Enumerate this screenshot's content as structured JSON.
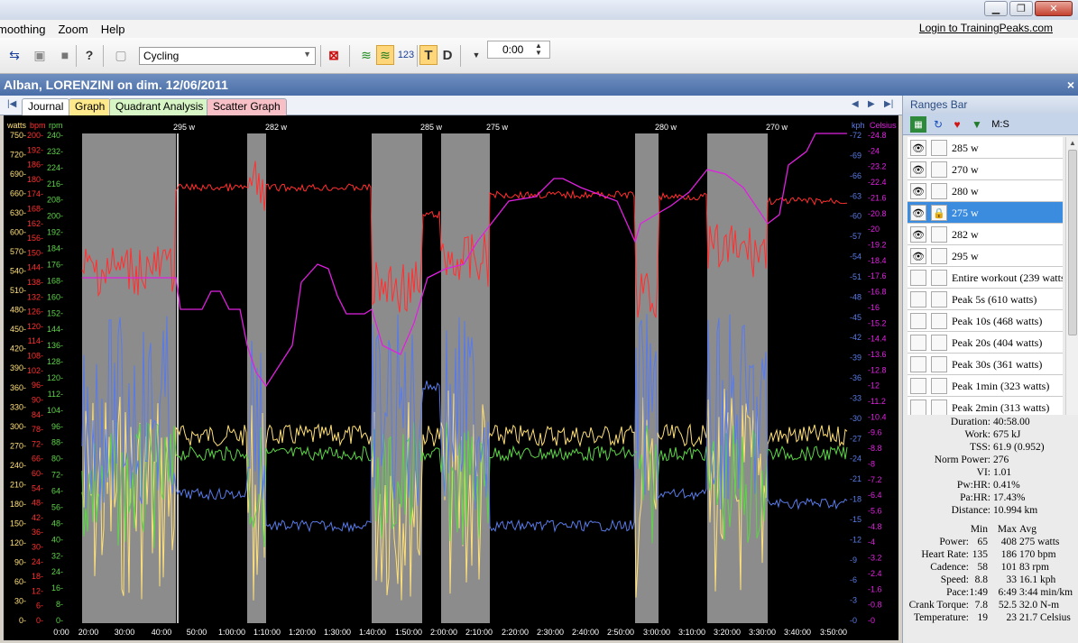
{
  "menu": [
    "moothing",
    "Zoom",
    "Help"
  ],
  "login_link": "Login to TrainingPeaks.com",
  "toolbar": {
    "sport": "Cycling",
    "time_value": "0:00",
    "t_label": "T",
    "d_label": "D",
    "numbers_icon_label": "123"
  },
  "workout_title": "Alban, LORENZINI on dim. 12/06/2011",
  "close_label": "×",
  "tabs": [
    "Journal",
    "Graph",
    "Quadrant Analysis",
    "Scatter Graph"
  ],
  "colors": {
    "watts": "#ffe07a",
    "bpm": "#ff3030",
    "rpm": "#5fd34a",
    "kph": "#5a7be6",
    "celsius": "#e020e0",
    "shade": "#8c8c8c",
    "selected_row": "#3b8cdf"
  },
  "chart_data": {
    "type": "line",
    "axis_headers": {
      "watts": "watts",
      "bpm": "bpm",
      "rpm": "rpm",
      "kph": "kph",
      "celsius": "Celsius"
    },
    "watts_ticks": [
      "750-",
      "720-",
      "690-",
      "660-",
      "630-",
      "600-",
      "570-",
      "540-",
      "510-",
      "480-",
      "450-",
      "420-",
      "390-",
      "360-",
      "330-",
      "300-",
      "270-",
      "240-",
      "210-",
      "180-",
      "150-",
      "120-",
      "90-",
      "60-",
      "30-",
      "0-"
    ],
    "bpm_ticks": [
      "200-",
      "192-",
      "186-",
      "180-",
      "174-",
      "168-",
      "162-",
      "156-",
      "150-",
      "144-",
      "138-",
      "132-",
      "126-",
      "120-",
      "114-",
      "108-",
      "102-",
      "96-",
      "90-",
      "84-",
      "78-",
      "72-",
      "66-",
      "60-",
      "54-",
      "48-",
      "42-",
      "36-",
      "30-",
      "24-",
      "18-",
      "12-",
      "6-",
      "0-"
    ],
    "rpm_ticks": [
      "240-",
      "232-",
      "224-",
      "216-",
      "208-",
      "200-",
      "192-",
      "184-",
      "176-",
      "168-",
      "160-",
      "152-",
      "144-",
      "136-",
      "128-",
      "120-",
      "112-",
      "104-",
      "96-",
      "88-",
      "80-",
      "72-",
      "64-",
      "56-",
      "48-",
      "40-",
      "32-",
      "24-",
      "16-",
      "8-",
      "0-"
    ],
    "kph_ticks": [
      "-72",
      "-69",
      "-66",
      "-63",
      "-60",
      "-57",
      "-54",
      "-51",
      "-48",
      "-45",
      "-42",
      "-39",
      "-36",
      "-33",
      "-30",
      "-27",
      "-24",
      "-21",
      "-18",
      "-15",
      "-12",
      "-9",
      "-6",
      "-3",
      "-0"
    ],
    "celsius_ticks": [
      "-24.8",
      "-24",
      "-23.2",
      "-22.4",
      "-21.6",
      "-20.8",
      "-20",
      "-19.2",
      "-18.4",
      "-17.6",
      "-16.8",
      "-16",
      "-15.2",
      "-14.4",
      "-13.6",
      "-12.8",
      "-12",
      "-11.2",
      "-10.4",
      "-9.6",
      "-8.8",
      "-8",
      "-7.2",
      "-6.4",
      "-5.6",
      "-4.8",
      "-4",
      "-3.2",
      "-2.4",
      "-1.6",
      "-0.8",
      "-0"
    ],
    "x_ticks": [
      "0:00",
      "20:00",
      "30:00",
      "40:00",
      "50:00",
      "1:00:00",
      "1:10:00",
      "1:20:00",
      "1:30:00",
      "1:40:00",
      "1:50:00",
      "2:00:00",
      "2:10:00",
      "2:20:00",
      "2:30:00",
      "2:40:00",
      "2:50:00",
      "3:00:00",
      "3:10:00",
      "3:20:00",
      "3:30:00",
      "3:40:00",
      "3:50:00"
    ],
    "range_labels": [
      "295 w",
      "282 w",
      "285 w",
      "275 w",
      "280 w",
      "270 w"
    ]
  },
  "ranges_bar": {
    "title": "Ranges Bar",
    "ms_label": "M:S",
    "rows": [
      {
        "label": "285 w",
        "eye": true,
        "selected": false
      },
      {
        "label": "270 w",
        "eye": true,
        "selected": false
      },
      {
        "label": "280 w",
        "eye": true,
        "selected": false
      },
      {
        "label": "275 w",
        "eye": true,
        "selected": true
      },
      {
        "label": "282 w",
        "eye": true,
        "selected": false
      },
      {
        "label": "295 w",
        "eye": true,
        "selected": false
      },
      {
        "label": "Entire workout (239 watts",
        "eye": false,
        "selected": false
      },
      {
        "label": "Peak 5s (610 watts)",
        "eye": false,
        "selected": false
      },
      {
        "label": "Peak 10s (468 watts)",
        "eye": false,
        "selected": false
      },
      {
        "label": "Peak 20s (404 watts)",
        "eye": false,
        "selected": false
      },
      {
        "label": "Peak 30s (361 watts)",
        "eye": false,
        "selected": false
      },
      {
        "label": "Peak 1min (323 watts)",
        "eye": false,
        "selected": false
      },
      {
        "label": "Peak 2min (313 watts)",
        "eye": false,
        "selected": false
      }
    ],
    "summary": [
      {
        "k": "Duration:",
        "v": "40:58.00"
      },
      {
        "k": "Work:",
        "v": "675 kJ"
      },
      {
        "k": "TSS:",
        "v": "61.9 (0.952)"
      },
      {
        "k": "Norm Power:",
        "v": "276"
      },
      {
        "k": "VI:",
        "v": "1.01"
      },
      {
        "k": "Pw:HR:",
        "v": "0.41%"
      },
      {
        "k": "Pa:HR:",
        "v": "17.43%"
      },
      {
        "k": "Distance:",
        "v": "10.994 km"
      }
    ],
    "stats_header": {
      "min": "Min",
      "max": "Max",
      "avg": "Avg"
    },
    "stats": [
      {
        "k": "Power:",
        "min": "65",
        "max": "408",
        "avg": "275 watts"
      },
      {
        "k": "Heart Rate:",
        "min": "135",
        "max": "186",
        "avg": "170 bpm"
      },
      {
        "k": "Cadence:",
        "min": "58",
        "max": "101",
        "avg": "83 rpm"
      },
      {
        "k": "Speed:",
        "min": "8.8",
        "max": "33",
        "avg": "16.1 kph"
      },
      {
        "k": "Pace:",
        "min": "1:49",
        "max": "6:49",
        "avg": "3:44 min/km"
      },
      {
        "k": "Crank Torque:",
        "min": "7.8",
        "max": "52.5",
        "avg": "32.0 N-m"
      },
      {
        "k": "Temperature:",
        "min": "19",
        "max": "23",
        "avg": "21.7 Celsius"
      }
    ]
  }
}
